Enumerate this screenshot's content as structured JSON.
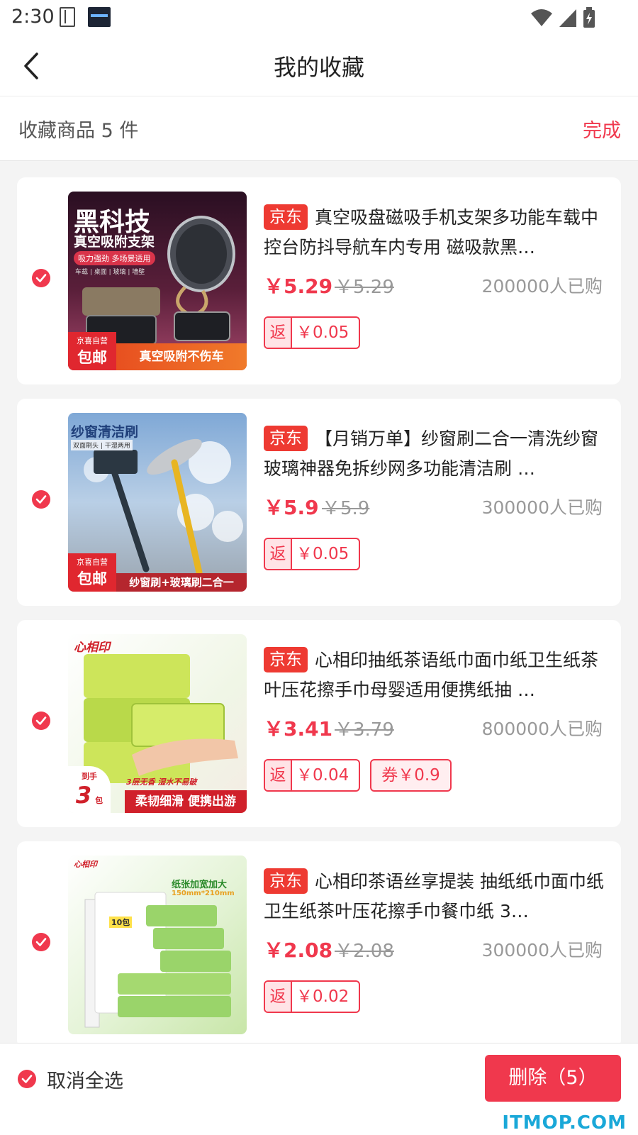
{
  "status": {
    "time": "2:30"
  },
  "header": {
    "title": "我的收藏"
  },
  "subbar": {
    "count_label": "收藏商品 5 件",
    "done_label": "完成"
  },
  "products": [
    {
      "tag": "京东",
      "name": "真空吸盘磁吸手机支架多功能车载中控台防抖导航车内专用 磁吸款黑…",
      "price": "￥5.29",
      "old_price": "￥5.29",
      "sold": "200000人已购",
      "rebate_key": "返",
      "rebate_val": "￥0.05",
      "coupon": "",
      "checked": true,
      "thumb": {
        "headline": "黑科技",
        "subline": "真空吸附支架",
        "pill": "吸力强劲 多场景适用",
        "mini": "车载 | 桌面 | 玻璃 | 墙壁",
        "corner_top": "京喜自营",
        "corner_big": "包邮",
        "footer": "真空吸附不伤车"
      }
    },
    {
      "tag": "京东",
      "name": "【月销万单】纱窗刷二合一清洗纱窗玻璃神器免拆纱网多功能清洁刷 …",
      "price": "￥5.9",
      "old_price": "￥5.9",
      "sold": "300000人已购",
      "rebate_key": "返",
      "rebate_val": "￥0.05",
      "coupon": "",
      "checked": true,
      "thumb": {
        "headline": "纱窗清洁刷",
        "mini": "双面刷头 | 干湿两用",
        "corner_top": "京喜自营",
        "corner_big": "包邮",
        "footer": "纱窗刷+玻璃刷二合一"
      }
    },
    {
      "tag": "京东",
      "name": "心相印抽纸茶语纸巾面巾纸卫生纸茶叶压花擦手巾母婴适用便携纸抽 …",
      "price": "￥3.41",
      "old_price": "￥3.79",
      "sold": "800000人已购",
      "rebate_key": "返",
      "rebate_val": "￥0.04",
      "coupon": "券￥0.9",
      "checked": true,
      "thumb": {
        "brand": "心相印",
        "badge_top": "到手",
        "badge_num": "3",
        "badge_unit": "包",
        "note": "3层无香 湿水不易破",
        "footer": "柔韧细滑 便携出游"
      }
    },
    {
      "tag": "京东",
      "name": "心相印茶语丝享提装 抽纸纸巾面巾纸卫生纸茶叶压花擦手巾餐巾纸 3…",
      "price": "￥2.08",
      "old_price": "￥2.08",
      "sold": "300000人已购",
      "rebate_key": "返",
      "rebate_val": "￥0.02",
      "coupon": "",
      "checked": true,
      "thumb": {
        "brand": "心相印",
        "note": "纸张加宽加大",
        "size": "150mm*210mm",
        "count": "10包"
      }
    }
  ],
  "bottombar": {
    "select_label": "取消全选",
    "delete_label": "删除（5）"
  },
  "watermark": "ITMOP.COM",
  "colors": {
    "accent": "#f0384d",
    "jd_tag": "#ee3a32"
  }
}
